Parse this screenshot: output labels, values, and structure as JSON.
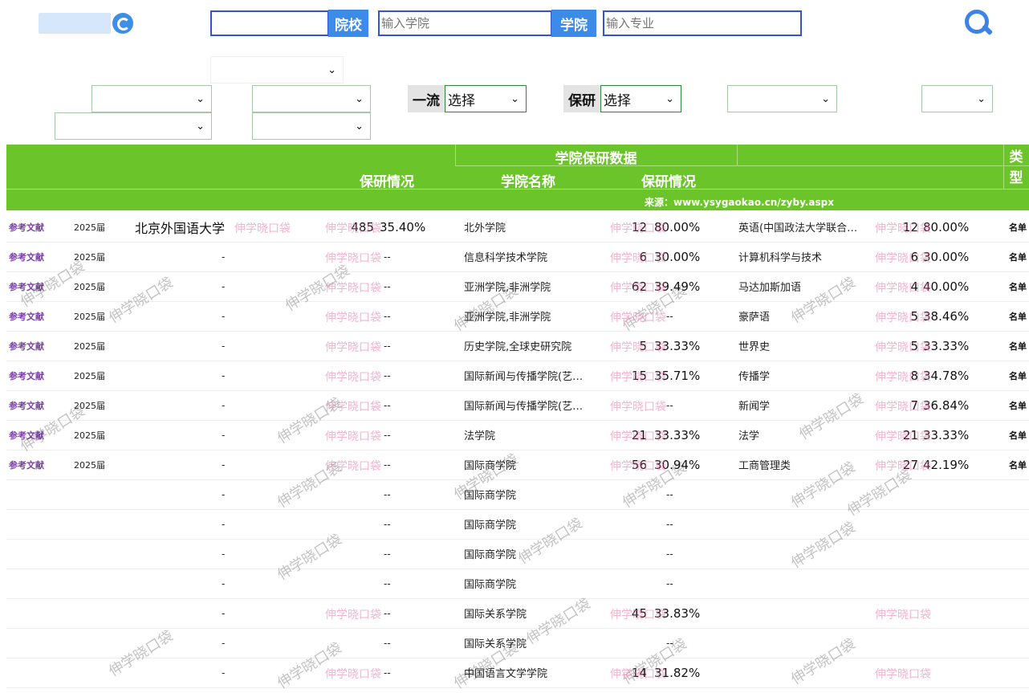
{
  "search": {
    "school_button": "院校",
    "college_placeholder": "输入学院",
    "college_button": "学院",
    "major_placeholder": "输入专业"
  },
  "filters": {
    "first_class_label": "一流",
    "first_class_value": "选择",
    "baoyan_label": "保研",
    "baoyan_value": "选择"
  },
  "table": {
    "header": {
      "group_college": "学院保研数据",
      "col_baoyan_1": "保研情况",
      "col_college_name": "学院名称",
      "col_baoyan_2": "保研情况",
      "col_type": "类型",
      "source": "来源：www.ysygaokao.cn/zyby.aspx"
    },
    "rows": [
      {
        "ref": "参考文献",
        "year": "2025届",
        "uni": "北京外国语大学",
        "uni_count": "485",
        "uni_rate": "35.40%",
        "college": "北外学院",
        "c_count": "12",
        "c_rate": "80.00%",
        "major": "英语(中国政法大学联合…",
        "m_count": "12",
        "m_rate": "80.00%",
        "list": "名单"
      },
      {
        "ref": "参考文献",
        "year": "2025届",
        "uni": "-",
        "uni_count": "",
        "uni_rate": "--",
        "college": "信息科学技术学院",
        "c_count": "6",
        "c_rate": "30.00%",
        "major": "计算机科学与技术",
        "m_count": "6",
        "m_rate": "30.00%",
        "list": "名单"
      },
      {
        "ref": "参考文献",
        "year": "2025届",
        "uni": "-",
        "uni_count": "",
        "uni_rate": "--",
        "college": "亚洲学院,非洲学院",
        "c_count": "62",
        "c_rate": "39.49%",
        "major": "马达加斯加语",
        "m_count": "4",
        "m_rate": "40.00%",
        "list": "名单"
      },
      {
        "ref": "参考文献",
        "year": "2025届",
        "uni": "-",
        "uni_count": "",
        "uni_rate": "--",
        "college": "亚洲学院,非洲学院",
        "c_count": "",
        "c_rate": "--",
        "major": "豪萨语",
        "m_count": "5",
        "m_rate": "38.46%",
        "list": "名单"
      },
      {
        "ref": "参考文献",
        "year": "2025届",
        "uni": "-",
        "uni_count": "",
        "uni_rate": "--",
        "college": "历史学院,全球史研究院",
        "c_count": "5",
        "c_rate": "33.33%",
        "major": "世界史",
        "m_count": "5",
        "m_rate": "33.33%",
        "list": "名单"
      },
      {
        "ref": "参考文献",
        "year": "2025届",
        "uni": "-",
        "uni_count": "",
        "uni_rate": "--",
        "college": "国际新闻与传播学院(艺…",
        "c_count": "15",
        "c_rate": "35.71%",
        "major": "传播学",
        "m_count": "8",
        "m_rate": "34.78%",
        "list": "名单"
      },
      {
        "ref": "参考文献",
        "year": "2025届",
        "uni": "-",
        "uni_count": "",
        "uni_rate": "--",
        "college": "国际新闻与传播学院(艺…",
        "c_count": "",
        "c_rate": "--",
        "major": "新闻学",
        "m_count": "7",
        "m_rate": "36.84%",
        "list": "名单"
      },
      {
        "ref": "参考文献",
        "year": "2025届",
        "uni": "-",
        "uni_count": "",
        "uni_rate": "--",
        "college": "法学院",
        "c_count": "21",
        "c_rate": "33.33%",
        "major": "法学",
        "m_count": "21",
        "m_rate": "33.33%",
        "list": "名单"
      },
      {
        "ref": "参考文献",
        "year": "2025届",
        "uni": "-",
        "uni_count": "",
        "uni_rate": "--",
        "college": "国际商学院",
        "c_count": "56",
        "c_rate": "30.94%",
        "major": "工商管理类",
        "m_count": "27",
        "m_rate": "42.19%",
        "list": "名单"
      },
      {
        "ref": "",
        "year": "",
        "uni": "-",
        "uni_count": "",
        "uni_rate": "--",
        "college": "国际商学院",
        "c_count": "",
        "c_rate": "--",
        "major": "",
        "m_count": "",
        "m_rate": "",
        "list": ""
      },
      {
        "ref": "",
        "year": "",
        "uni": "-",
        "uni_count": "",
        "uni_rate": "--",
        "college": "国际商学院",
        "c_count": "",
        "c_rate": "--",
        "major": "",
        "m_count": "",
        "m_rate": "",
        "list": ""
      },
      {
        "ref": "",
        "year": "",
        "uni": "-",
        "uni_count": "",
        "uni_rate": "--",
        "college": "国际商学院",
        "c_count": "",
        "c_rate": "--",
        "major": "",
        "m_count": "",
        "m_rate": "",
        "list": ""
      },
      {
        "ref": "",
        "year": "",
        "uni": "-",
        "uni_count": "",
        "uni_rate": "--",
        "college": "国际商学院",
        "c_count": "",
        "c_rate": "--",
        "major": "",
        "m_count": "",
        "m_rate": "",
        "list": ""
      },
      {
        "ref": "",
        "year": "",
        "uni": "-",
        "uni_count": "",
        "uni_rate": "--",
        "college": "国际关系学院",
        "c_count": "45",
        "c_rate": "33.83%",
        "major": "",
        "m_count": "",
        "m_rate": "",
        "list": ""
      },
      {
        "ref": "",
        "year": "",
        "uni": "-",
        "uni_count": "",
        "uni_rate": "--",
        "college": "国际关系学院",
        "c_count": "",
        "c_rate": "--",
        "major": "",
        "m_count": "",
        "m_rate": "",
        "list": ""
      },
      {
        "ref": "",
        "year": "",
        "uni": "-",
        "uni_count": "",
        "uni_rate": "--",
        "college": "中国语言文学学院",
        "c_count": "14",
        "c_rate": "31.82%",
        "major": "",
        "m_count": "",
        "m_rate": "",
        "list": ""
      }
    ]
  },
  "watermark": "伸学晓口袋",
  "colors": {
    "header_green": "#6bc52a",
    "accent_blue": "#3d8be8",
    "link_purple": "#7b3ea8"
  }
}
